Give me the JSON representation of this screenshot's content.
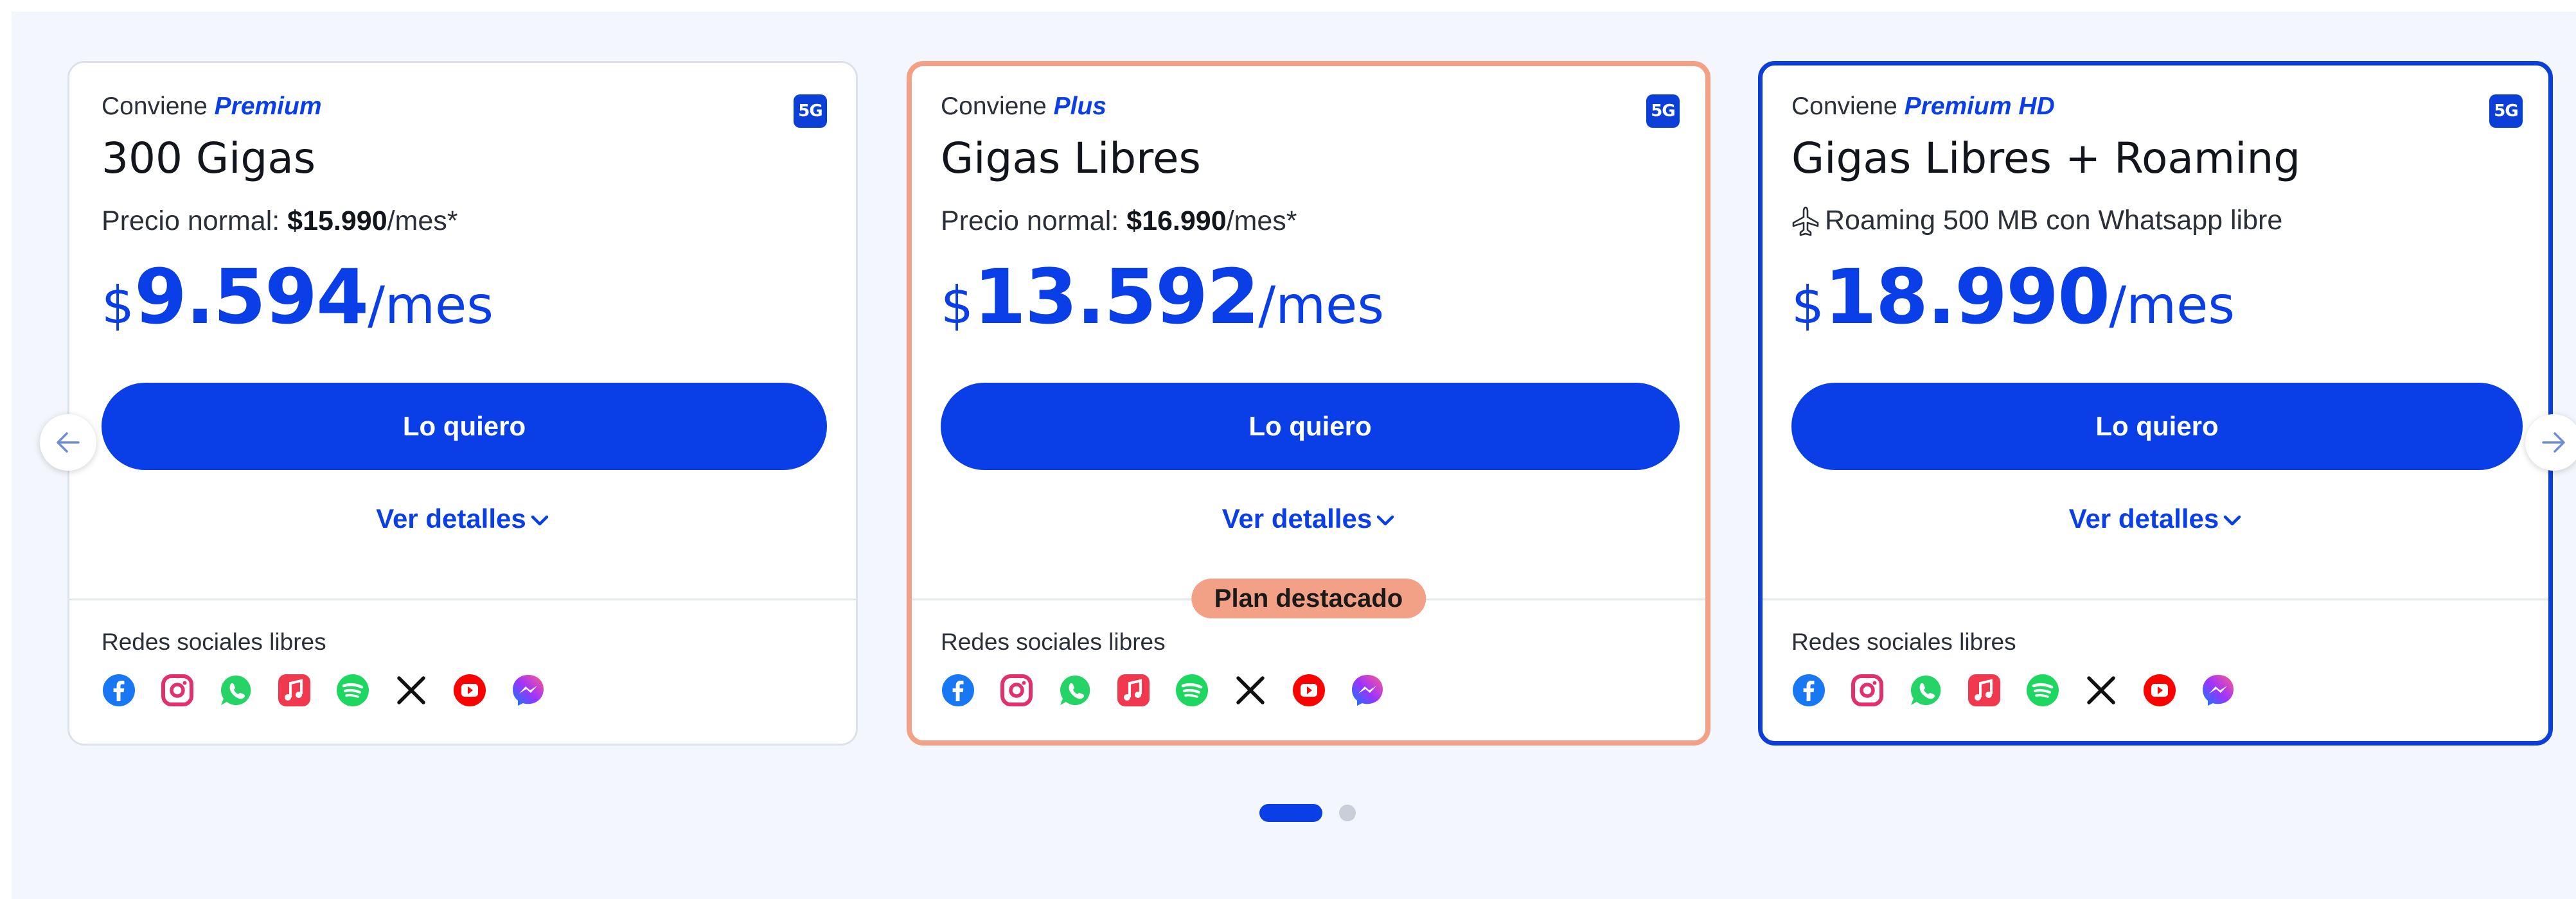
{
  "nav": {
    "prev_icon": "arrow-left-icon",
    "next_icon": "arrow-right-icon"
  },
  "colors": {
    "brand_blue": "#0a3ee6",
    "featured_border": "#f3a186",
    "background": "#f3f6fc"
  },
  "cards": [
    {
      "conviene_label": "Conviene",
      "plan_name": "Premium",
      "badge": "5G",
      "title": "300 Gigas",
      "normal_label": "Precio normal: ",
      "normal_price": "$15.990",
      "normal_suffix": "/mes*",
      "price_currency": "$",
      "price_amount": "9.594",
      "price_period": "/mes",
      "cta": "Lo quiero",
      "details": "Ver detalles",
      "social_label": "Redes sociales libres"
    },
    {
      "conviene_label": "Conviene",
      "plan_name": "Plus",
      "badge": "5G",
      "title": "Gigas Libres",
      "normal_label": "Precio normal: ",
      "normal_price": "$16.990",
      "normal_suffix": "/mes*",
      "price_currency": "$",
      "price_amount": "13.592",
      "price_period": "/mes",
      "cta": "Lo quiero",
      "details": "Ver detalles",
      "featured_label": "Plan destacado",
      "social_label": "Redes sociales libres"
    },
    {
      "conviene_label": "Conviene",
      "plan_name": "Premium HD",
      "badge": "5G",
      "title": "Gigas Libres + Roaming",
      "roaming_text": "Roaming 500 MB con Whatsapp libre",
      "price_currency": "$",
      "price_amount": "18.990",
      "price_period": "/mes",
      "cta": "Lo quiero",
      "details": "Ver detalles",
      "social_label": "Redes sociales libres"
    }
  ],
  "social_icons": [
    "facebook-icon",
    "instagram-icon",
    "whatsapp-icon",
    "apple-music-icon",
    "spotify-icon",
    "x-icon",
    "youtube-icon",
    "messenger-icon"
  ],
  "pagination": {
    "pages": 2,
    "active": 1
  }
}
